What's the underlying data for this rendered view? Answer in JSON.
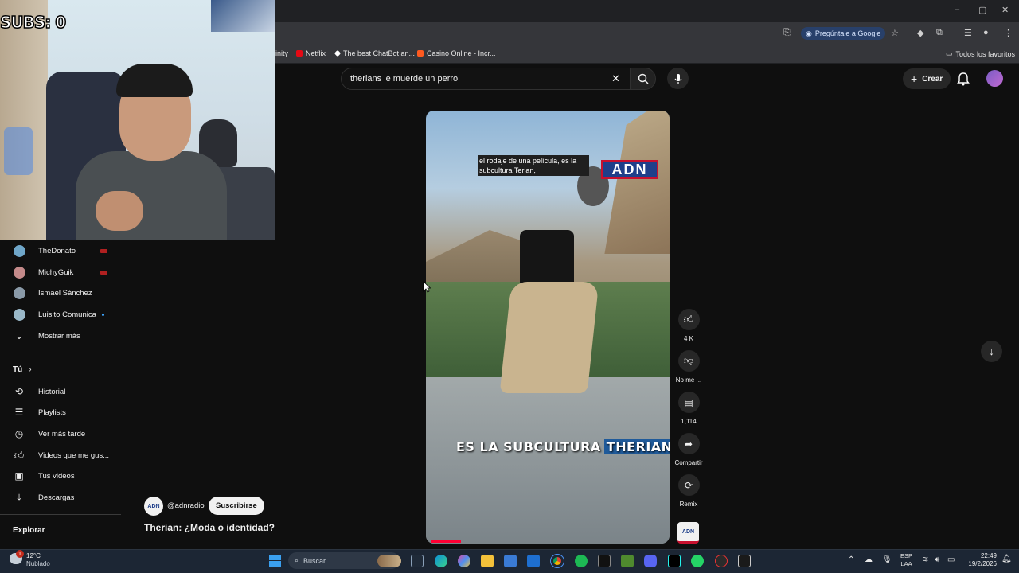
{
  "overlay": {
    "subs_text": "SUBS: 0"
  },
  "browser": {
    "window_controls": [
      "–",
      "▢",
      "✕"
    ],
    "google_pill": "Pregúntale a Google",
    "bookmarks": [
      {
        "label": "inity"
      },
      {
        "label": "Netflix",
        "color": "#e50914"
      },
      {
        "label": "The best ChatBot an...",
        "color": "#ffffff"
      },
      {
        "label": "Casino Online - Incr...",
        "color": "#ff5a1f"
      }
    ],
    "all_bookmarks": "Todos los favoritos"
  },
  "youtube": {
    "search_query": "therians le muerde un perro",
    "create_label": "Crear",
    "sidebar": {
      "subscriptions": [
        {
          "name": "TheDonato",
          "live": true,
          "avatar_color": "#6fa6c9"
        },
        {
          "name": "MichyGuik",
          "live": true,
          "avatar_color": "#c48a8a"
        },
        {
          "name": "Ismael Sánchez",
          "live": false,
          "avatar_color": "#8a9aa8"
        },
        {
          "name": "Luisito Comunica",
          "live": false,
          "dot": true,
          "avatar_color": "#9ab8c8"
        }
      ],
      "show_more": "Mostrar más",
      "you_section": "Tú",
      "you_items": [
        "Historial",
        "Playlists",
        "Ver más tarde",
        "Videos que me gus...",
        "Tus videos",
        "Descargas"
      ],
      "explore": "Explorar"
    },
    "short": {
      "caption_top": "el rodaje de una película, es la subcultura Terian,",
      "logo_text": "ADN",
      "caption_bottom_a": "ES LA SUBCULTURA",
      "caption_bottom_b": "THERIAN",
      "channel_avatar": "ADN",
      "channel_handle": "@adnradio",
      "subscribe_label": "Suscribirse",
      "title": "Therian: ¿Moda o identidad?"
    },
    "actions": [
      {
        "icon": "like-icon",
        "label": "4 K"
      },
      {
        "icon": "dislike-icon",
        "label": "No me ..."
      },
      {
        "icon": "comment-icon",
        "label": "1,114"
      },
      {
        "icon": "share-icon",
        "label": "Compartir"
      },
      {
        "icon": "remix-icon",
        "label": "Remix"
      }
    ]
  },
  "taskbar": {
    "weather_temp": "12°C",
    "weather_desc": "Nublado",
    "weather_badge": "1",
    "search_placeholder": "Buscar",
    "lang_line1": "ESP",
    "lang_line2": "LAA",
    "time": "22:49",
    "date": "19/2/2026"
  }
}
